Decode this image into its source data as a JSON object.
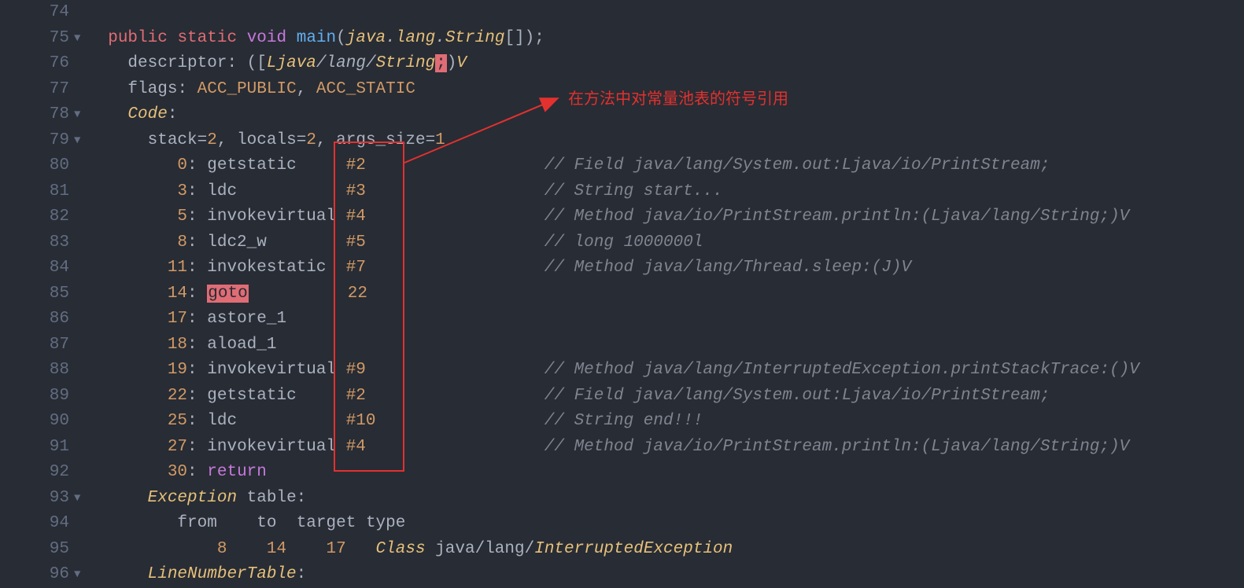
{
  "gutter": {
    "l74": "74",
    "l75": "75",
    "l76": "76",
    "l77": "77",
    "l78": "78",
    "l79": "79",
    "l80": "80",
    "l81": "81",
    "l82": "82",
    "l83": "83",
    "l84": "84",
    "l85": "85",
    "l86": "86",
    "l87": "87",
    "l88": "88",
    "l89": "89",
    "l90": "90",
    "l91": "91",
    "l92": "92",
    "l93": "93",
    "l94": "94",
    "l95": "95",
    "l96": "96"
  },
  "fold": {
    "tri": "▼"
  },
  "code": {
    "l75": {
      "sp": "  ",
      "public": "public",
      "static": "static",
      "void": "void",
      "main": "main",
      "lp": "(",
      "java": "java",
      "dot": ".",
      "lang": "lang",
      "String": "String",
      "br": "[]",
      "rp": ")",
      "semi": ";"
    },
    "l76": {
      "sp": "    ",
      "descriptor": "descriptor",
      "colon": ": ",
      "lp": "(",
      "lb": "[",
      "L": "L",
      "java": "java",
      "sl": "/",
      "lang": "lang",
      "String": "String",
      "semi": ";",
      "rp": ")",
      "V": "V"
    },
    "l77": {
      "sp": "    ",
      "flags": "flags",
      "colon": ": ",
      "acc_public": "ACC_PUBLIC",
      "comma": ", ",
      "acc_static": "ACC_STATIC"
    },
    "l78": {
      "sp": "    ",
      "Code": "Code",
      "colon": ":"
    },
    "l79": {
      "sp": "      ",
      "stack": "stack",
      "eq": "=",
      "n2": "2",
      "c1": ", ",
      "locals": "locals",
      "n2b": "2",
      "c2": ", ",
      "args": "args_size",
      "n1": "1"
    },
    "l80": {
      "idx": "0",
      "op": "getstatic",
      "ref": "#2",
      "cmt": "// Field java/lang/System.out:Ljava/io/PrintStream;"
    },
    "l81": {
      "idx": "3",
      "op": "ldc",
      "ref": "#3",
      "cmt": "// String start..."
    },
    "l82": {
      "idx": "5",
      "op": "invokevirtual",
      "ref": "#4",
      "cmt": "// Method java/io/PrintStream.println:(Ljava/lang/String;)V"
    },
    "l83": {
      "idx": "8",
      "op": "ldc2_w",
      "ref": "#5",
      "cmt": "// long 1000000l"
    },
    "l84": {
      "idx": "11",
      "op": "invokestatic",
      "ref": "#7",
      "cmt": "// Method java/lang/Thread.sleep:(J)V"
    },
    "l85": {
      "idx": "14",
      "op": "goto",
      "ref": "22"
    },
    "l86": {
      "idx": "17",
      "op": "astore_1"
    },
    "l87": {
      "idx": "18",
      "op": "aload_1"
    },
    "l88": {
      "idx": "19",
      "op": "invokevirtual",
      "ref": "#9",
      "cmt": "// Method java/lang/InterruptedException.printStackTrace:()V"
    },
    "l89": {
      "idx": "22",
      "op": "getstatic",
      "ref": "#2",
      "cmt": "// Field java/lang/System.out:Ljava/io/PrintStream;"
    },
    "l90": {
      "idx": "25",
      "op": "ldc",
      "ref": "#10",
      "cmt": "// String end!!!"
    },
    "l91": {
      "idx": "27",
      "op": "invokevirtual",
      "ref": "#4",
      "cmt": "// Method java/io/PrintStream.println:(Ljava/lang/String;)V"
    },
    "l92": {
      "idx": "30",
      "op": "return"
    },
    "l93": {
      "sp": "      ",
      "Exception": "Exception",
      "gap": " ",
      "table": "table",
      "colon": ":"
    },
    "l94": {
      "sp": "         ",
      "from": "from",
      "g1": "    ",
      "to": "to",
      "g2": "  ",
      "target": "target",
      "g3": " ",
      "type": "type"
    },
    "l95": {
      "sp": "             ",
      "n8": "8",
      "g1": "    ",
      "n14": "14",
      "g2": "    ",
      "n17": "17",
      "g3": "   ",
      "Class": "Class",
      "g4": " ",
      "java": "java",
      "sl": "/",
      "lang": "lang",
      "InterruptedException": "InterruptedException"
    },
    "l96": {
      "sp": "      ",
      "LineNumberTable": "LineNumberTable",
      "colon": ":"
    }
  },
  "annotation": {
    "text": "在方法中对常量池表的符号引用"
  },
  "colors": {
    "bg": "#282c34",
    "fg": "#abb2bf",
    "red": "#e06c75",
    "purple": "#c678dd",
    "blue": "#61afef",
    "yellow": "#e5c07b",
    "orange": "#d19a66",
    "green": "#98c379",
    "comment": "#7f848e",
    "gutter": "#636d83",
    "box": "#e2312f"
  }
}
